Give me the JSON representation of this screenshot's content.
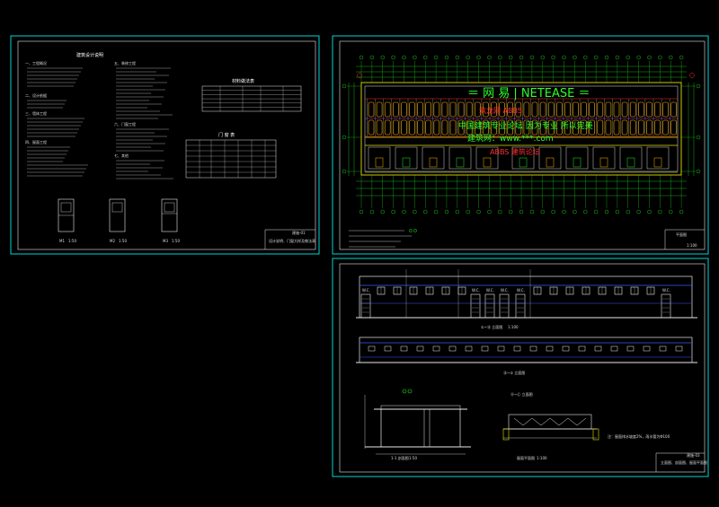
{
  "colors": {
    "background": "#000000",
    "sheet_border": "#00d6d6",
    "line_white": "#e8e8e8",
    "line_yellow": "#e0e000",
    "line_green": "#22ee22",
    "line_red": "#ff2a2a",
    "line_blue": "#3b5bff",
    "line_magenta": "#ff40ff",
    "window_orange": "#ffb400"
  },
  "sheet1": {
    "title": "建筑设计说明",
    "section_headings": [
      "一、工程概况",
      "二、设计依据",
      "三、墙体工程",
      "四、屋面工程",
      "五、装修工程",
      "六、门窗工程",
      "七、其他"
    ],
    "materials_table_title": "材料做法表",
    "door_table_title": "门 窗 表",
    "door_labels": [
      "M1",
      "M2",
      "M3"
    ],
    "door_label_scale": "1:50",
    "titleblock": [
      "设计说明、门窗大样及做法表",
      "建施-01"
    ]
  },
  "sheet2": {
    "plan_title": "平面图",
    "plan_scale": "1:100",
    "titleblock": [
      "一层平面图",
      "建施-02"
    ],
    "watermark": {
      "line1": "＝ 网 易 | NETEASE ＝",
      "line2": "中国建筑专业论坛 因为专业 所以完美",
      "line3": "建筑网：www.***.com",
      "red1": "筑龙网 ABBS",
      "red2": "ABBS 建筑论坛"
    }
  },
  "sheet3": {
    "elev1_title": "①~⑮ 立面图",
    "elev1_scale": "1:100",
    "elev2_title": "⑮~① 立面图",
    "section_title": "1-1 剖面图",
    "section_scale": "1:50",
    "roof_title": "屋面平面图",
    "roof_scale": "1:100",
    "roof_note": "注：屋面排水坡度2%，雨水管为Φ100",
    "side_elev_title": "Ⓐ~Ⓒ 立面图",
    "wc_label": "W.C.",
    "titleblock": [
      "立面图、剖面图、屋面平面图",
      "建施-03"
    ]
  }
}
